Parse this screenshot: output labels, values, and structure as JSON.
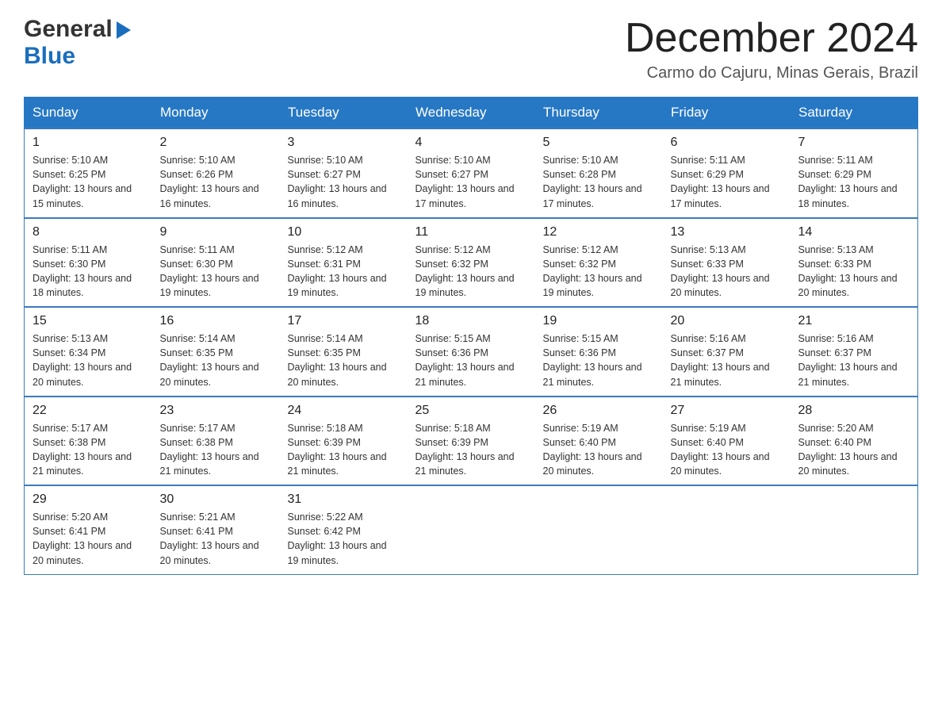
{
  "header": {
    "logo_line1": "General",
    "logo_line2": "Blue",
    "month_title": "December 2024",
    "location": "Carmo do Cajuru, Minas Gerais, Brazil"
  },
  "days_of_week": [
    "Sunday",
    "Monday",
    "Tuesday",
    "Wednesday",
    "Thursday",
    "Friday",
    "Saturday"
  ],
  "weeks": [
    [
      {
        "day": "1",
        "sunrise": "Sunrise: 5:10 AM",
        "sunset": "Sunset: 6:25 PM",
        "daylight": "Daylight: 13 hours and 15 minutes."
      },
      {
        "day": "2",
        "sunrise": "Sunrise: 5:10 AM",
        "sunset": "Sunset: 6:26 PM",
        "daylight": "Daylight: 13 hours and 16 minutes."
      },
      {
        "day": "3",
        "sunrise": "Sunrise: 5:10 AM",
        "sunset": "Sunset: 6:27 PM",
        "daylight": "Daylight: 13 hours and 16 minutes."
      },
      {
        "day": "4",
        "sunrise": "Sunrise: 5:10 AM",
        "sunset": "Sunset: 6:27 PM",
        "daylight": "Daylight: 13 hours and 17 minutes."
      },
      {
        "day": "5",
        "sunrise": "Sunrise: 5:10 AM",
        "sunset": "Sunset: 6:28 PM",
        "daylight": "Daylight: 13 hours and 17 minutes."
      },
      {
        "day": "6",
        "sunrise": "Sunrise: 5:11 AM",
        "sunset": "Sunset: 6:29 PM",
        "daylight": "Daylight: 13 hours and 17 minutes."
      },
      {
        "day": "7",
        "sunrise": "Sunrise: 5:11 AM",
        "sunset": "Sunset: 6:29 PM",
        "daylight": "Daylight: 13 hours and 18 minutes."
      }
    ],
    [
      {
        "day": "8",
        "sunrise": "Sunrise: 5:11 AM",
        "sunset": "Sunset: 6:30 PM",
        "daylight": "Daylight: 13 hours and 18 minutes."
      },
      {
        "day": "9",
        "sunrise": "Sunrise: 5:11 AM",
        "sunset": "Sunset: 6:30 PM",
        "daylight": "Daylight: 13 hours and 19 minutes."
      },
      {
        "day": "10",
        "sunrise": "Sunrise: 5:12 AM",
        "sunset": "Sunset: 6:31 PM",
        "daylight": "Daylight: 13 hours and 19 minutes."
      },
      {
        "day": "11",
        "sunrise": "Sunrise: 5:12 AM",
        "sunset": "Sunset: 6:32 PM",
        "daylight": "Daylight: 13 hours and 19 minutes."
      },
      {
        "day": "12",
        "sunrise": "Sunrise: 5:12 AM",
        "sunset": "Sunset: 6:32 PM",
        "daylight": "Daylight: 13 hours and 19 minutes."
      },
      {
        "day": "13",
        "sunrise": "Sunrise: 5:13 AM",
        "sunset": "Sunset: 6:33 PM",
        "daylight": "Daylight: 13 hours and 20 minutes."
      },
      {
        "day": "14",
        "sunrise": "Sunrise: 5:13 AM",
        "sunset": "Sunset: 6:33 PM",
        "daylight": "Daylight: 13 hours and 20 minutes."
      }
    ],
    [
      {
        "day": "15",
        "sunrise": "Sunrise: 5:13 AM",
        "sunset": "Sunset: 6:34 PM",
        "daylight": "Daylight: 13 hours and 20 minutes."
      },
      {
        "day": "16",
        "sunrise": "Sunrise: 5:14 AM",
        "sunset": "Sunset: 6:35 PM",
        "daylight": "Daylight: 13 hours and 20 minutes."
      },
      {
        "day": "17",
        "sunrise": "Sunrise: 5:14 AM",
        "sunset": "Sunset: 6:35 PM",
        "daylight": "Daylight: 13 hours and 20 minutes."
      },
      {
        "day": "18",
        "sunrise": "Sunrise: 5:15 AM",
        "sunset": "Sunset: 6:36 PM",
        "daylight": "Daylight: 13 hours and 21 minutes."
      },
      {
        "day": "19",
        "sunrise": "Sunrise: 5:15 AM",
        "sunset": "Sunset: 6:36 PM",
        "daylight": "Daylight: 13 hours and 21 minutes."
      },
      {
        "day": "20",
        "sunrise": "Sunrise: 5:16 AM",
        "sunset": "Sunset: 6:37 PM",
        "daylight": "Daylight: 13 hours and 21 minutes."
      },
      {
        "day": "21",
        "sunrise": "Sunrise: 5:16 AM",
        "sunset": "Sunset: 6:37 PM",
        "daylight": "Daylight: 13 hours and 21 minutes."
      }
    ],
    [
      {
        "day": "22",
        "sunrise": "Sunrise: 5:17 AM",
        "sunset": "Sunset: 6:38 PM",
        "daylight": "Daylight: 13 hours and 21 minutes."
      },
      {
        "day": "23",
        "sunrise": "Sunrise: 5:17 AM",
        "sunset": "Sunset: 6:38 PM",
        "daylight": "Daylight: 13 hours and 21 minutes."
      },
      {
        "day": "24",
        "sunrise": "Sunrise: 5:18 AM",
        "sunset": "Sunset: 6:39 PM",
        "daylight": "Daylight: 13 hours and 21 minutes."
      },
      {
        "day": "25",
        "sunrise": "Sunrise: 5:18 AM",
        "sunset": "Sunset: 6:39 PM",
        "daylight": "Daylight: 13 hours and 21 minutes."
      },
      {
        "day": "26",
        "sunrise": "Sunrise: 5:19 AM",
        "sunset": "Sunset: 6:40 PM",
        "daylight": "Daylight: 13 hours and 20 minutes."
      },
      {
        "day": "27",
        "sunrise": "Sunrise: 5:19 AM",
        "sunset": "Sunset: 6:40 PM",
        "daylight": "Daylight: 13 hours and 20 minutes."
      },
      {
        "day": "28",
        "sunrise": "Sunrise: 5:20 AM",
        "sunset": "Sunset: 6:40 PM",
        "daylight": "Daylight: 13 hours and 20 minutes."
      }
    ],
    [
      {
        "day": "29",
        "sunrise": "Sunrise: 5:20 AM",
        "sunset": "Sunset: 6:41 PM",
        "daylight": "Daylight: 13 hours and 20 minutes."
      },
      {
        "day": "30",
        "sunrise": "Sunrise: 5:21 AM",
        "sunset": "Sunset: 6:41 PM",
        "daylight": "Daylight: 13 hours and 20 minutes."
      },
      {
        "day": "31",
        "sunrise": "Sunrise: 5:22 AM",
        "sunset": "Sunset: 6:42 PM",
        "daylight": "Daylight: 13 hours and 19 minutes."
      },
      null,
      null,
      null,
      null
    ]
  ]
}
